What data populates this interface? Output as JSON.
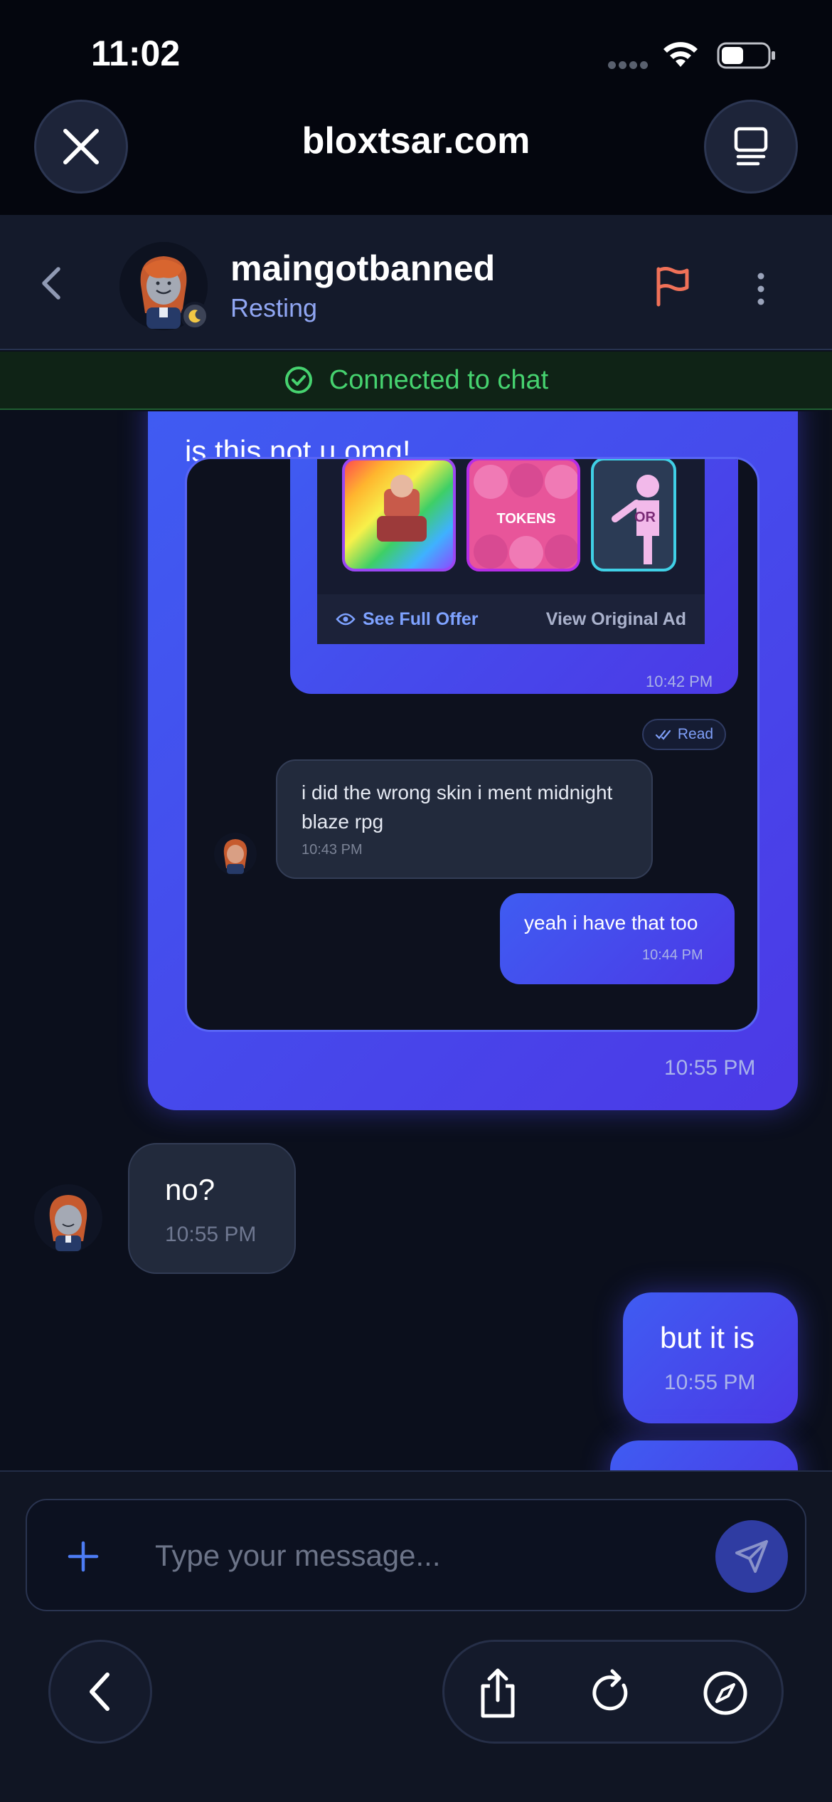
{
  "status_bar": {
    "time": "11:02"
  },
  "browser": {
    "url": "bloxtsar.com",
    "close_icon": "close-icon",
    "tabs_icon": "tabs-icon"
  },
  "chat_header": {
    "name": "maingotbanned",
    "status": "Resting",
    "flag_color": "#f07158"
  },
  "connection": {
    "text": "Connected to chat",
    "color": "#46d26f"
  },
  "messages": [
    {
      "direction": "out",
      "text": "is this not u omg!",
      "time": "10:55 PM",
      "attachment": {
        "offer": {
          "thumb_2_label": "TOKENS",
          "thumb_3_label": "OR",
          "see_full_offer": "See Full Offer",
          "view_original_ad": "View Original Ad",
          "time": "10:42 PM"
        },
        "read_label": "Read",
        "inner_in": {
          "text": "i did the wrong skin i ment midnight blaze rpg",
          "time": "10:43 PM"
        },
        "inner_out": {
          "text": "yeah i have that too",
          "time": "10:44 PM"
        }
      }
    },
    {
      "direction": "in",
      "text": "no?",
      "time": "10:55 PM"
    },
    {
      "direction": "out",
      "text": "but it is",
      "time": "10:55 PM"
    }
  ],
  "composer": {
    "placeholder": "Type your message..."
  },
  "colors": {
    "accent": "#4a4cec",
    "background": "#0b0f1c",
    "incoming_bubble": "#222a3c"
  }
}
